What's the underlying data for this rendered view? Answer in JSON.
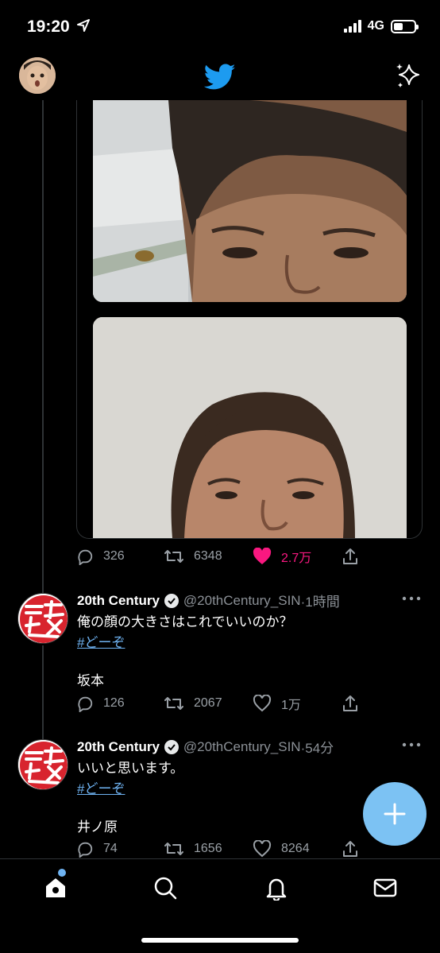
{
  "status": {
    "time": "19:20",
    "network": "4G"
  },
  "thread1": {
    "actions": {
      "replies": "326",
      "retweets": "6348",
      "likes": "2.7万"
    }
  },
  "tweets": [
    {
      "name": "20th Century",
      "handle": "@20thCentury_SIN",
      "time": "·1時間",
      "text": "俺の顔の大きさはこれでいいのか？",
      "hashtag": "#どーぞ",
      "sign": "坂本",
      "replies": "126",
      "retweets": "2067",
      "likes": "1万"
    },
    {
      "name": "20th Century",
      "handle": "@20thCentury_SIN",
      "time": "·54分",
      "text": "いいと思います。",
      "hashtag": "#どーぞ",
      "sign": "井ノ原",
      "replies": "74",
      "retweets": "1656",
      "likes": "8264"
    }
  ],
  "colors": {
    "accent": "#1d9bf0",
    "like": "#f91880",
    "fab": "#7cc2f3"
  },
  "icons": [
    "location-arrow-icon",
    "signal-icon",
    "battery-icon",
    "twitter-bird-icon",
    "sparkle-icon",
    "reply-icon",
    "retweet-icon",
    "like-icon",
    "share-icon",
    "more-icon",
    "verified-icon",
    "compose-icon",
    "home-icon",
    "search-icon",
    "notifications-icon",
    "messages-icon"
  ]
}
